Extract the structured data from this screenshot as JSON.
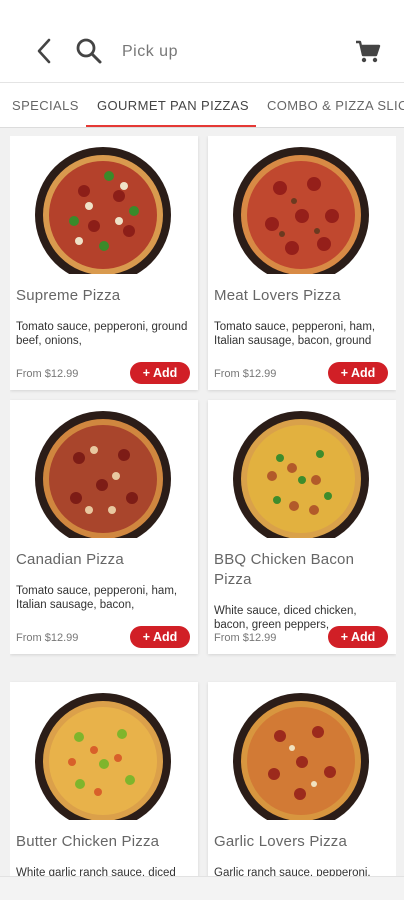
{
  "header": {
    "title": "Pick up",
    "back_icon": "chevron-left-icon",
    "search_icon": "search-icon",
    "cart_icon": "cart-icon"
  },
  "tabs": [
    {
      "label": "SPECIALS",
      "active": false
    },
    {
      "label": "GOURMET PAN PIZZAS",
      "active": true
    },
    {
      "label": "COMBO & PIZZA SLICES",
      "active": false
    }
  ],
  "colors": {
    "accent": "#e53935",
    "button": "#d11f26"
  },
  "products": [
    {
      "name": "Supreme Pizza",
      "description": "Tomato sauce, pepperoni, ground beef, onions,",
      "price": "From $12.99",
      "add_label": "+ Add"
    },
    {
      "name": "Meat Lovers Pizza",
      "description": "Tomato sauce, pepperoni, ham, Italian sausage, bacon, ground",
      "price": "From $12.99",
      "add_label": "+ Add"
    },
    {
      "name": "Canadian Pizza",
      "description": "Tomato sauce, pepperoni, ham, Italian sausage, bacon,",
      "price": "From $12.99",
      "add_label": "+ Add"
    },
    {
      "name": "BBQ Chicken Bacon Pizza",
      "description": "White sauce, diced chicken, bacon, green peppers,",
      "price": "From $12.99",
      "add_label": "+ Add"
    },
    {
      "name": "Butter Chicken Pizza",
      "description": "White garlic ranch sauce, diced",
      "price": "",
      "add_label": ""
    },
    {
      "name": "Garlic Lovers Pizza",
      "description": "Garlic ranch sauce, pepperoni,",
      "price": "",
      "add_label": ""
    }
  ]
}
